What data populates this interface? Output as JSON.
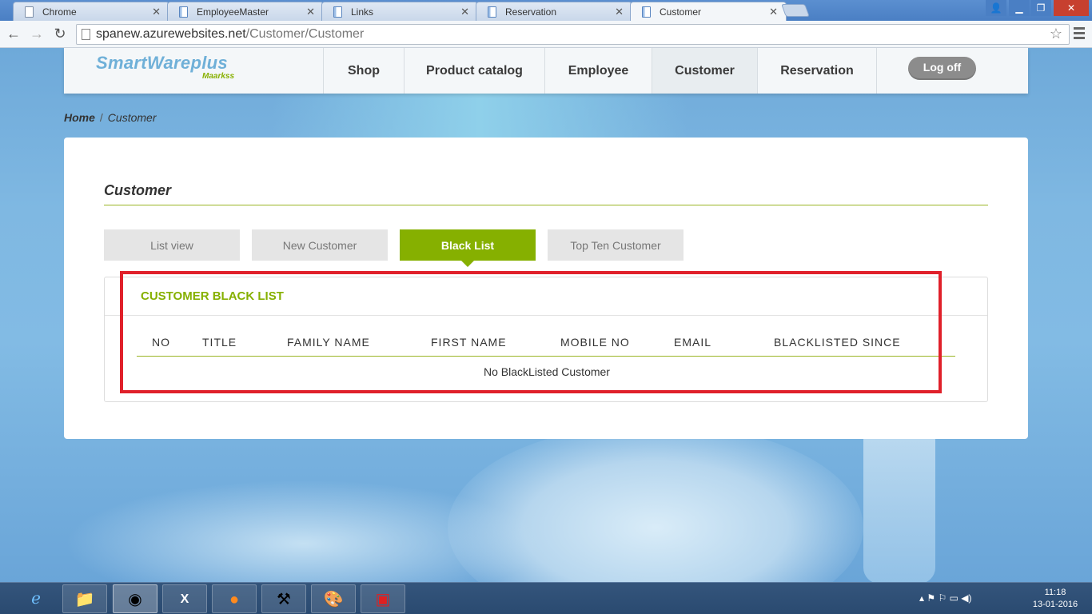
{
  "browser": {
    "tabs": [
      {
        "title": "Chrome",
        "active": false
      },
      {
        "title": "EmployeeMaster",
        "active": false
      },
      {
        "title": "Links",
        "active": false
      },
      {
        "title": "Reservation",
        "active": false
      },
      {
        "title": "Customer",
        "active": true
      }
    ],
    "url_host": "spanew.azurewebsites.net",
    "url_path": "/Customer/Customer"
  },
  "site": {
    "logo": "SmartWareplus",
    "logo_sub": "Maarkss",
    "nav": [
      "Shop",
      "Product catalog",
      "Employee",
      "Customer",
      "Reservation"
    ],
    "active_nav": "Customer",
    "logoff_label": "Log off"
  },
  "breadcrumb": {
    "home": "Home",
    "current": "Customer"
  },
  "main": {
    "title": "Customer",
    "tabs": [
      "List view",
      "New Customer",
      "Black List",
      "Top Ten Customer"
    ],
    "active_tab": "Black List",
    "panel_title": "CUSTOMER BLACK LIST",
    "columns": [
      "NO",
      "TITLE",
      "FAMILY NAME",
      "FIRST NAME",
      "MOBILE NO",
      "EMAIL",
      "BLACKLISTED SINCE"
    ],
    "empty_message": "No BlackListed Customer"
  },
  "taskbar": {
    "apps": [
      "internet-explorer-icon",
      "file-explorer-icon",
      "chrome-icon",
      "excel-icon",
      "firefox-icon",
      "tools-icon",
      "paint-icon",
      "app-icon"
    ],
    "time": "11:18",
    "date": "13-01-2016"
  },
  "colors": {
    "accent": "#86b000",
    "highlight": "#e0202a"
  }
}
